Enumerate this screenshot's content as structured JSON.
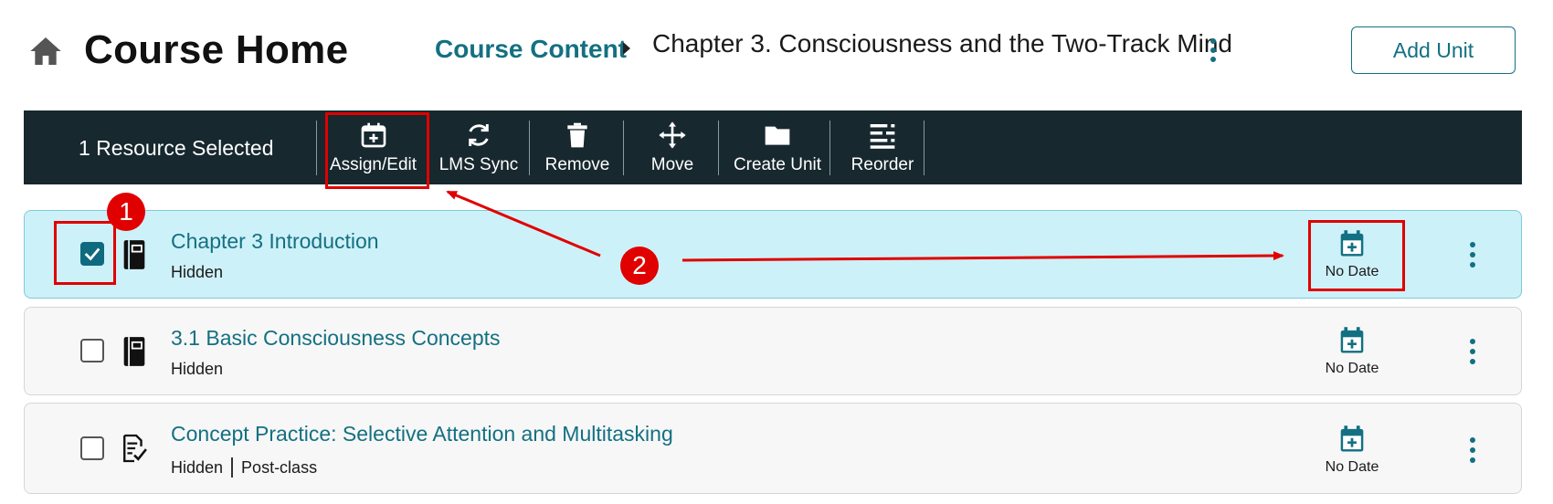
{
  "header": {
    "title": "Course Home",
    "breadcrumb_link": "Course Content",
    "breadcrumb_current": "Chapter 3. Consciousness and the Two-Track Mind",
    "add_unit_label": "Add Unit"
  },
  "toolbar": {
    "selected_text": "1 Resource Selected",
    "buttons": [
      {
        "label": "Assign/Edit",
        "icon": "calendar-plus-icon"
      },
      {
        "label": "LMS Sync",
        "icon": "sync-icon"
      },
      {
        "label": "Remove",
        "icon": "trash-icon"
      },
      {
        "label": "Move",
        "icon": "move-arrows-icon"
      },
      {
        "label": "Create Unit",
        "icon": "folder-icon"
      },
      {
        "label": "Reorder",
        "icon": "reorder-icon"
      }
    ]
  },
  "resources": [
    {
      "title": "Chapter 3 Introduction",
      "status": "Hidden",
      "tag": "",
      "date": "No Date",
      "checked": true,
      "icon": "book-icon"
    },
    {
      "title": "3.1 Basic Consciousness Concepts",
      "status": "Hidden",
      "tag": "",
      "date": "No Date",
      "checked": false,
      "icon": "book-icon"
    },
    {
      "title": "Concept Practice: Selective Attention and Multitasking",
      "status": "Hidden",
      "tag": "Post-class",
      "date": "No Date",
      "checked": false,
      "icon": "assignment-check-icon"
    }
  ],
  "annotations": {
    "badge_1": "1",
    "badge_2": "2"
  },
  "colors": {
    "accent": "#137082",
    "toolbar_bg": "#17282f",
    "selected_row_bg": "#cdf1f8",
    "annotation_red": "#e00000"
  }
}
